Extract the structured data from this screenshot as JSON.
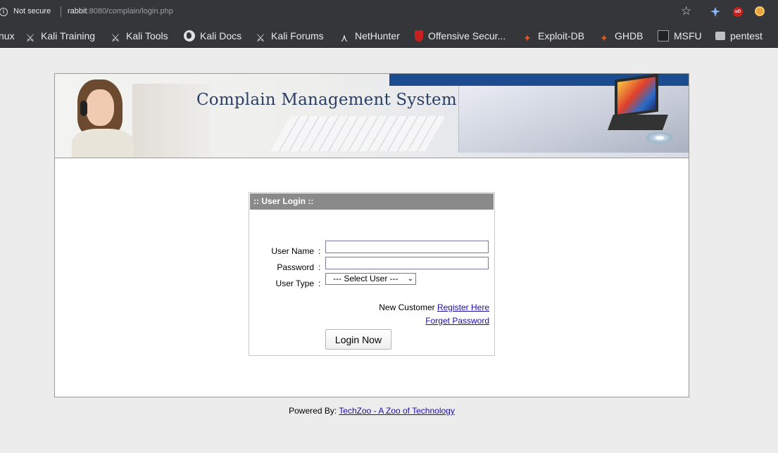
{
  "browser": {
    "security_label": "Not secure",
    "url_host": "rabbit",
    "url_rest": ":8080/complain/login.php"
  },
  "bookmarks": [
    {
      "label": "nux",
      "icon": "none"
    },
    {
      "label": "Kali Training",
      "icon": "kali-dragon-icon"
    },
    {
      "label": "Kali Tools",
      "icon": "kali-dragon-icon"
    },
    {
      "label": "Kali Docs",
      "icon": "globe-icon"
    },
    {
      "label": "Kali Forums",
      "icon": "kali-dragon-icon"
    },
    {
      "label": "NetHunter",
      "icon": "nethunter-icon"
    },
    {
      "label": "Offensive Secur...",
      "icon": "offsec-icon"
    },
    {
      "label": "Exploit-DB",
      "icon": "exploitdb-icon"
    },
    {
      "label": "GHDB",
      "icon": "exploitdb-icon"
    },
    {
      "label": "MSFU",
      "icon": "metasploit-icon"
    },
    {
      "label": "pentest",
      "icon": "folder-icon"
    }
  ],
  "banner": {
    "title": "Complain Management System"
  },
  "login": {
    "heading": ":: User Login ::",
    "username_label": "User Name",
    "password_label": "Password",
    "usertype_label": "User Type",
    "colon": ":",
    "username_value": "",
    "password_value": "",
    "usertype_selected": "--- Select User ---",
    "new_customer_text": "New Customer",
    "register_link": "Register Here",
    "forgot_link": "Forget Password",
    "submit_label": "Login Now"
  },
  "footer": {
    "powered_by": "Powered By:",
    "link_text": "TechZoo - A Zoo of Technology"
  }
}
